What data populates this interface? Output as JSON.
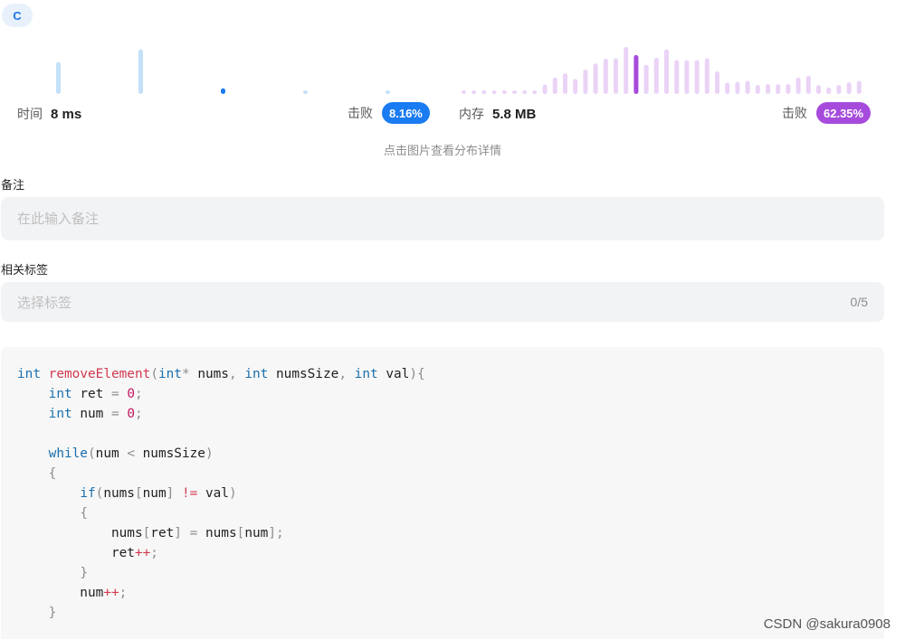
{
  "language_badge": "C",
  "runtime": {
    "label": "时间",
    "value": "8 ms",
    "beats_label": "击败",
    "beats_value": "8.16%",
    "distribution": [
      0.68,
      0.95,
      0.12,
      0.05,
      0.05
    ],
    "highlight_index": 2,
    "colors": {
      "bar": "#c4e0f9",
      "highlight": "#1a7bf2"
    }
  },
  "memory": {
    "label": "内存",
    "value": "5.8 MB",
    "beats_label": "击败",
    "beats_value": "62.35%",
    "distribution": [
      0.06,
      0.06,
      0.06,
      0.06,
      0.06,
      0.06,
      0.06,
      0.06,
      0.2,
      0.35,
      0.44,
      0.32,
      0.52,
      0.65,
      0.75,
      0.76,
      1.0,
      0.83,
      0.62,
      0.77,
      0.95,
      0.72,
      0.72,
      0.72,
      0.76,
      0.48,
      0.24,
      0.26,
      0.28,
      0.19,
      0.21,
      0.21,
      0.21,
      0.35,
      0.39,
      0.19,
      0.14,
      0.19,
      0.25,
      0.28
    ],
    "highlight_index": 17,
    "colors": {
      "bar": "#ead3f6",
      "highlight": "#a64bdc"
    }
  },
  "hint": "点击图片查看分布详情",
  "notes": {
    "label": "备注",
    "placeholder": "在此输入备注"
  },
  "tags": {
    "label": "相关标签",
    "placeholder": "选择标签",
    "counter": "0/5"
  },
  "code_lines": [
    [
      [
        "kw",
        "int"
      ],
      [
        "t",
        " "
      ],
      [
        "fn",
        "removeElement"
      ],
      [
        "op",
        "("
      ],
      [
        "kw",
        "int"
      ],
      [
        "op",
        "*"
      ],
      [
        "t",
        " nums"
      ],
      [
        "op",
        ","
      ],
      [
        "t",
        " "
      ],
      [
        "kw",
        "int"
      ],
      [
        "t",
        " numsSize"
      ],
      [
        "op",
        ","
      ],
      [
        "t",
        " "
      ],
      [
        "kw",
        "int"
      ],
      [
        "t",
        " val"
      ],
      [
        "op",
        ")"
      ],
      [
        "op",
        "{"
      ]
    ],
    [
      [
        "t",
        "    "
      ],
      [
        "kw",
        "int"
      ],
      [
        "t",
        " ret "
      ],
      [
        "op",
        "="
      ],
      [
        "t",
        " "
      ],
      [
        "num",
        "0"
      ],
      [
        "op",
        ";"
      ]
    ],
    [
      [
        "t",
        "    "
      ],
      [
        "kw",
        "int"
      ],
      [
        "t",
        " num "
      ],
      [
        "op",
        "="
      ],
      [
        "t",
        " "
      ],
      [
        "num",
        "0"
      ],
      [
        "op",
        ";"
      ]
    ],
    [],
    [
      [
        "t",
        "    "
      ],
      [
        "kw",
        "while"
      ],
      [
        "op",
        "("
      ],
      [
        "t",
        "num "
      ],
      [
        "op",
        "<"
      ],
      [
        "t",
        " numsSize"
      ],
      [
        "op",
        ")"
      ]
    ],
    [
      [
        "t",
        "    "
      ],
      [
        "op",
        "{"
      ]
    ],
    [
      [
        "t",
        "        "
      ],
      [
        "kw",
        "if"
      ],
      [
        "op",
        "("
      ],
      [
        "t",
        "nums"
      ],
      [
        "op",
        "["
      ],
      [
        "t",
        "num"
      ],
      [
        "op",
        "]"
      ],
      [
        "t",
        " "
      ],
      [
        "fn",
        "!="
      ],
      [
        "t",
        " val"
      ],
      [
        "op",
        ")"
      ]
    ],
    [
      [
        "t",
        "        "
      ],
      [
        "op",
        "{"
      ]
    ],
    [
      [
        "t",
        "            nums"
      ],
      [
        "op",
        "["
      ],
      [
        "t",
        "ret"
      ],
      [
        "op",
        "]"
      ],
      [
        "t",
        " "
      ],
      [
        "op",
        "="
      ],
      [
        "t",
        " nums"
      ],
      [
        "op",
        "["
      ],
      [
        "t",
        "num"
      ],
      [
        "op",
        "]"
      ],
      [
        "op",
        ";"
      ]
    ],
    [
      [
        "t",
        "            ret"
      ],
      [
        "fn",
        "++"
      ],
      [
        "op",
        ";"
      ]
    ],
    [
      [
        "t",
        "        "
      ],
      [
        "op",
        "}"
      ]
    ],
    [
      [
        "t",
        "        num"
      ],
      [
        "fn",
        "++"
      ],
      [
        "op",
        ";"
      ]
    ],
    [
      [
        "t",
        "    "
      ],
      [
        "op",
        "}"
      ]
    ]
  ],
  "watermark": "CSDN @sakura0908"
}
